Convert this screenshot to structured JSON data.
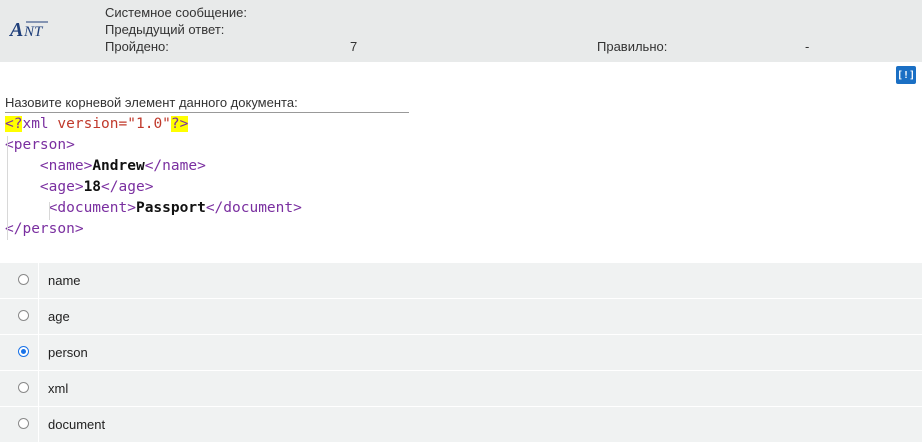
{
  "header": {
    "logo_text": "ANT",
    "system_message_label": "Системное сообщение:",
    "previous_answer_label": "Предыдущий ответ:",
    "passed_label": "Пройдено:",
    "passed_value": "7",
    "correct_label": "Правильно:",
    "correct_value": "-"
  },
  "help_button": {
    "label": "[!]"
  },
  "question": {
    "text": "Назовите корневой элемент данного документа:"
  },
  "code": {
    "decl_open": "<?",
    "decl_name": "xml",
    "decl_attr": " version=",
    "decl_val": "\"1.0\"",
    "decl_close": "?>",
    "person_open": "<person>",
    "name_open": "<name>",
    "name_text": "Andrew",
    "name_close": "</name>",
    "age_open": "<age>",
    "age_text": "18",
    "age_close": "</age>",
    "doc_open": "<document>",
    "doc_text": "Passport",
    "doc_close": "</document>",
    "person_close": "</person>"
  },
  "options": [
    {
      "label": "name",
      "checked": false
    },
    {
      "label": "age",
      "checked": false
    },
    {
      "label": "person",
      "checked": true
    },
    {
      "label": "xml",
      "checked": false
    },
    {
      "label": "document",
      "checked": false
    }
  ],
  "colors": {
    "header_bg": "#e8eaea",
    "accent": "#1a6fc4",
    "highlight": "#ffff00",
    "tag_color": "#7a2fa0",
    "attr_color": "#c0392b",
    "option_bg": "#f0f2f2"
  }
}
